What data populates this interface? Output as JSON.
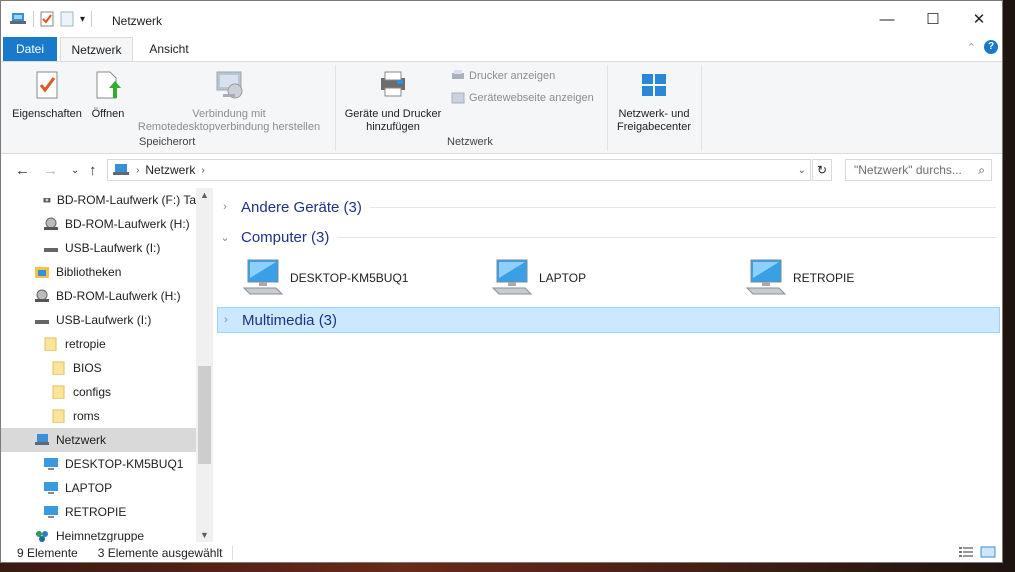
{
  "window": {
    "title": "Netzwerk",
    "minimize": "—",
    "maximize": "☐",
    "close": "✕"
  },
  "tabs": [
    "Datei",
    "Netzwerk",
    "Ansicht"
  ],
  "ribbon": {
    "eigenschaften": "Eigenschaften",
    "oeffnen": "Öffnen",
    "remote_line1": "Verbindung mit",
    "remote_line2": "Remotedesktopverbindung herstellen",
    "group_speicherort": "Speicherort",
    "geraete_line1": "Geräte und Drucker",
    "geraete_line2": "hinzufügen",
    "drucker": "Drucker anzeigen",
    "geraetewebseite": "Gerätewebseite anzeigen",
    "group_netzwerk": "Netzwerk",
    "center_line1": "Netzwerk- und",
    "center_line2": "Freigabecenter"
  },
  "address": {
    "crumb": "Netzwerk",
    "search_placeholder": "\"Netzwerk\" durchs..."
  },
  "nav_items": [
    {
      "label": "BD-ROM-Laufwerk (F:) Ta",
      "icon": "bd-drive-icon"
    },
    {
      "label": "BD-ROM-Laufwerk (H:)",
      "icon": "disc-drive-icon"
    },
    {
      "label": "USB-Laufwerk (I:)",
      "icon": "usb-drive-icon"
    },
    {
      "label": "Bibliotheken",
      "icon": "libraries-icon"
    },
    {
      "label": "BD-ROM-Laufwerk (H:)",
      "icon": "disc-drive-icon"
    },
    {
      "label": "USB-Laufwerk (I:)",
      "icon": "usb-drive-icon"
    },
    {
      "label": "retropie",
      "icon": "folder-icon"
    },
    {
      "label": "BIOS",
      "icon": "folder-icon"
    },
    {
      "label": "configs",
      "icon": "folder-icon"
    },
    {
      "label": "roms",
      "icon": "folder-icon"
    },
    {
      "label": "Netzwerk",
      "icon": "network-icon"
    },
    {
      "label": "DESKTOP-KM5BUQ1",
      "icon": "computer-icon"
    },
    {
      "label": "LAPTOP",
      "icon": "computer-icon"
    },
    {
      "label": "RETROPIE",
      "icon": "computer-icon"
    },
    {
      "label": "Heimnetzgruppe",
      "icon": "homegroup-icon"
    }
  ],
  "groups": {
    "andere": "Andere Geräte (3)",
    "computer": "Computer (3)",
    "multimedia": "Multimedia (3)"
  },
  "computers": [
    "DESKTOP-KM5BUQ1",
    "LAPTOP",
    "RETROPIE"
  ],
  "status": {
    "count": "9 Elemente",
    "selected": "3 Elemente ausgewählt"
  }
}
